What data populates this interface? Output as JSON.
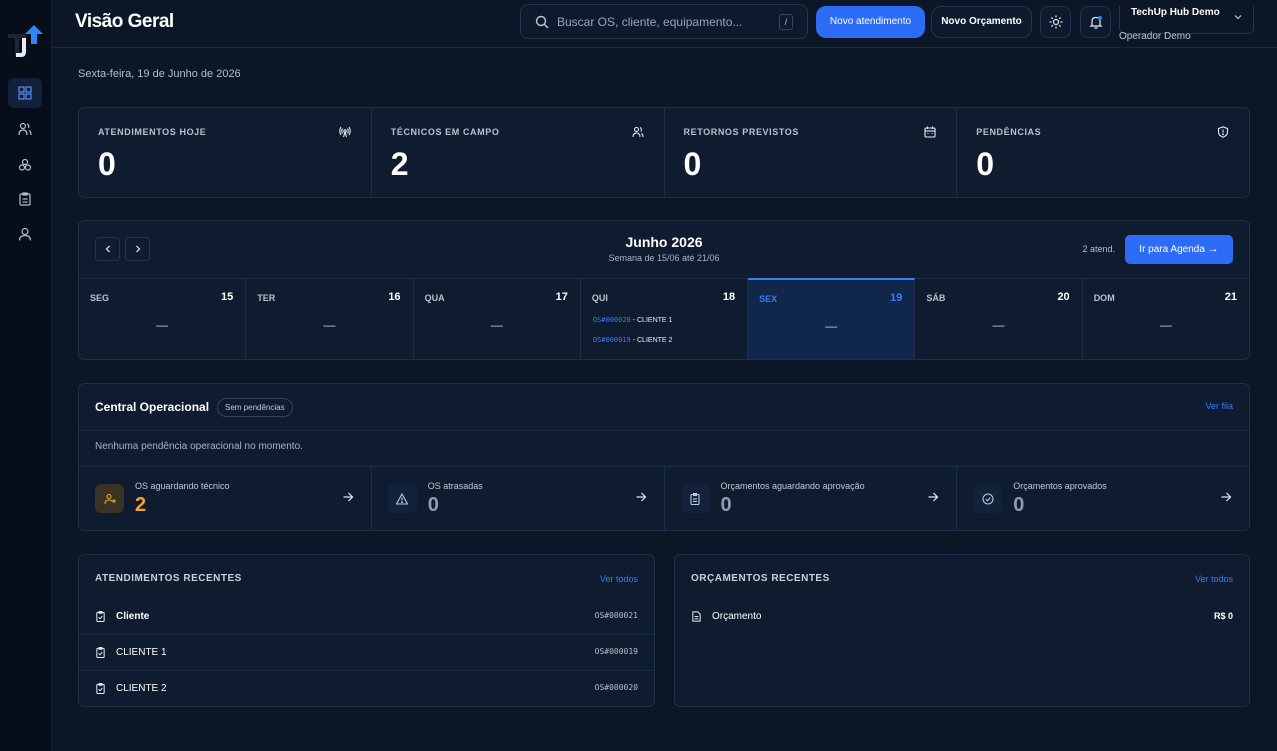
{
  "header": {
    "title": "Visão Geral",
    "search_placeholder": "Buscar OS, cliente, equipamento...",
    "search_shortcut": "/",
    "new_service_label": "Novo atendimento",
    "new_quote_label": "Novo Orçamento",
    "account_name": "TechUp Hub Demo",
    "account_role": "Operador Demo"
  },
  "sidebar": {
    "items": [
      {
        "icon": "dashboard-icon"
      },
      {
        "icon": "users-icon"
      },
      {
        "icon": "modules-icon"
      },
      {
        "icon": "clipboard-icon"
      },
      {
        "icon": "user-icon"
      }
    ]
  },
  "date_label": "Sexta-feira, 19 de Junho de 2026",
  "stats": [
    {
      "label": "ATENDIMENTOS HOJE",
      "value": "0",
      "icon": "broadcast-icon"
    },
    {
      "label": "TÉCNICOS EM CAMPO",
      "value": "2",
      "icon": "users-icon"
    },
    {
      "label": "RETORNOS PREVISTOS",
      "value": "0",
      "icon": "calendar-icon"
    },
    {
      "label": "PENDÊNCIAS",
      "value": "0",
      "icon": "alert-shield-icon"
    }
  ],
  "calendar": {
    "month": "Junho 2026",
    "week_range": "Semana de 15/06 até 21/06",
    "count": "2 atend.",
    "go_button": "Ir para Agenda",
    "empty_marker": "—",
    "days": [
      {
        "name": "SEG",
        "date": "15"
      },
      {
        "name": "TER",
        "date": "16"
      },
      {
        "name": "QUA",
        "date": "17"
      },
      {
        "name": "QUI",
        "date": "18",
        "events": [
          {
            "code": "OS#000020",
            "client": " - CLIENTE 1"
          },
          {
            "code": "OS#000019",
            "client": " - CLIENTE 2"
          }
        ]
      },
      {
        "name": "SEX",
        "date": "19"
      },
      {
        "name": "SÁB",
        "date": "20"
      },
      {
        "name": "DOM",
        "date": "21"
      }
    ]
  },
  "central": {
    "title": "Central Operacional",
    "badge": "Sem pendências",
    "link": "Ver fila",
    "message": "Nenhuma pendência operacional no momento.",
    "kpis": [
      {
        "label": "OS aguardando técnico",
        "value": "2",
        "icon": "user-plus-icon"
      },
      {
        "label": "OS atrasadas",
        "value": "0",
        "icon": "warning-triangle-icon"
      },
      {
        "label": "Orçamentos aguardando aprovação",
        "value": "0",
        "icon": "clipboard-icon"
      },
      {
        "label": "Orçamentos aprovados",
        "value": "0",
        "icon": "check-circle-icon"
      }
    ]
  },
  "recent_services": {
    "title": "ATENDIMENTOS RECENTES",
    "link": "Ver todos",
    "rows": [
      {
        "name": "Cliente",
        "code": "OS#000021"
      },
      {
        "name": "CLIENTE 1",
        "code": "OS#000019"
      },
      {
        "name": "CLIENTE 2",
        "code": "OS#000020"
      }
    ]
  },
  "recent_quotes": {
    "title": "ORÇAMENTOS RECENTES",
    "link": "Ver todos",
    "rows": [
      {
        "name": "Orçamento",
        "value": "R$ 0"
      }
    ]
  },
  "colors": {
    "accent": "#2d6cf6",
    "warning": "#f5a524",
    "background": "#0b1627"
  }
}
